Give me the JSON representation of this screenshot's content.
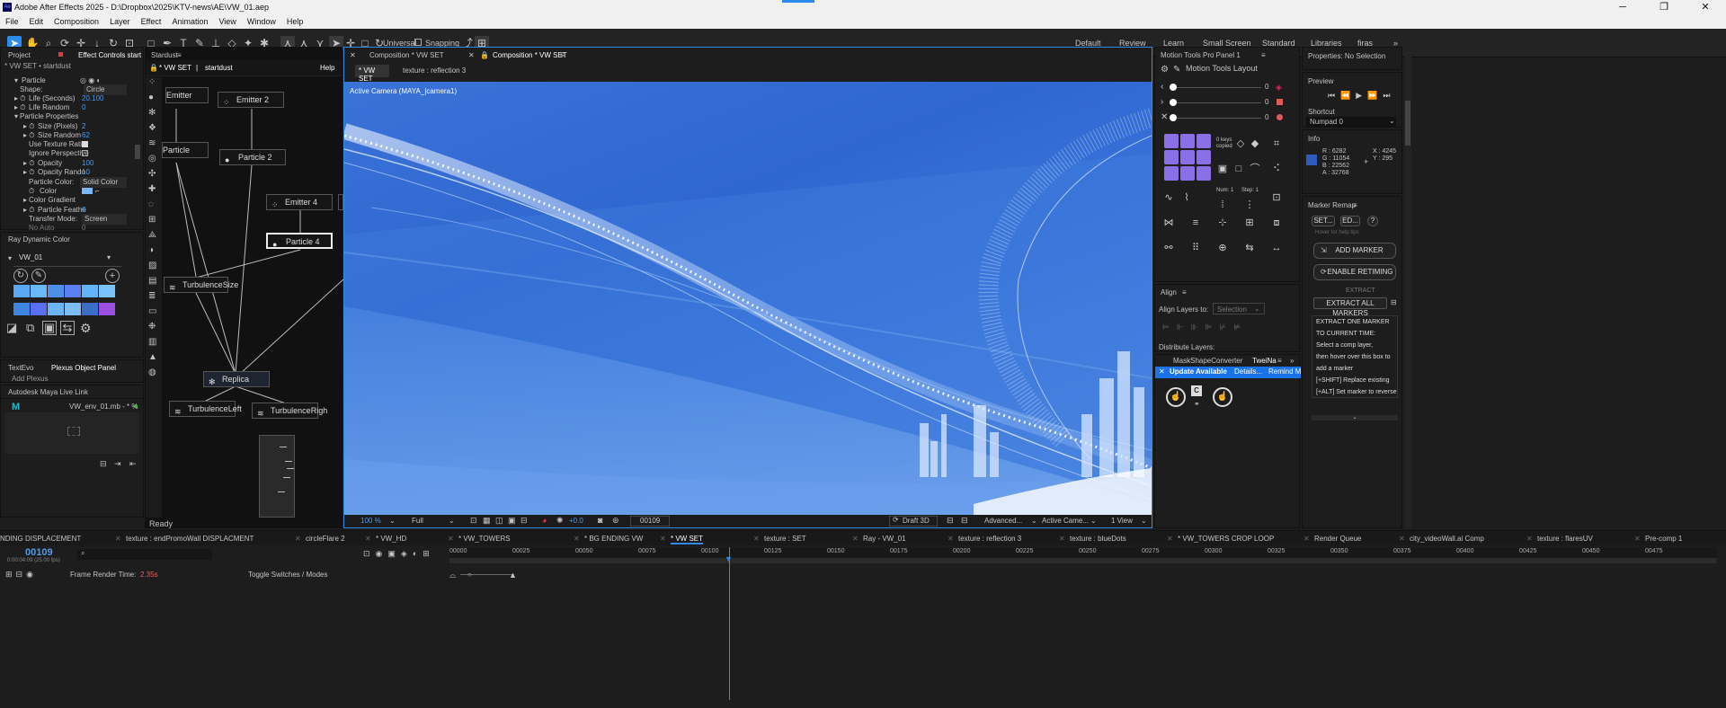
{
  "app": {
    "title": "Adobe After Effects 2025 - D:\\Dropbox\\2025\\KTV-news\\AE\\VW_01.aep",
    "window_buttons": [
      "─",
      "❐",
      "✕"
    ]
  },
  "menu": [
    "File",
    "Edit",
    "Composition",
    "Layer",
    "Effect",
    "Animation",
    "View",
    "Window",
    "Help"
  ],
  "toolbar": {
    "universal_label": "Universal",
    "snapping_label": "Snapping",
    "workspaces": [
      "Default",
      "Review",
      "Learn",
      "Small Screen",
      "Standard",
      "Libraries",
      "firas"
    ]
  },
  "project_panel": {
    "tab_project": "Project",
    "tab_effect_controls": "Effect Controls start",
    "layer_path": "* VW SET • startdust",
    "properties": [
      {
        "label": "Particle",
        "value": ""
      },
      {
        "label": "Shape:",
        "value": "Circle"
      },
      {
        "label": "Life (Seconds)",
        "value": "20.100"
      },
      {
        "label": "Life Random",
        "value": "0"
      },
      {
        "label": "Particle Properties",
        "value": ""
      },
      {
        "label": "Size (Pixels)",
        "value": "2"
      },
      {
        "label": "Size Random",
        "value": "62"
      },
      {
        "label": "Use Texture Ratio",
        "value": ""
      },
      {
        "label": "Ignore Perspective",
        "value": ""
      },
      {
        "label": "Opacity",
        "value": "100"
      },
      {
        "label": "Opacity Rando",
        "value": "10"
      },
      {
        "label": "Particle Color:",
        "value": "Solid Color"
      },
      {
        "label": "Color",
        "value": ""
      },
      {
        "label": "Color Gradient",
        "value": ""
      },
      {
        "label": "Particle Feathe",
        "value": "0"
      },
      {
        "label": "Transfer Mode:",
        "value": "Screen"
      },
      {
        "label": "No Auto",
        "value": "0"
      }
    ]
  },
  "ray_dynamic": {
    "title": "Ray Dynamic Color",
    "palette_name": "VW_01",
    "swatches": [
      "#5aa8f5",
      "#6ab8f7",
      "#4e8fea",
      "#5b7ff0",
      "#63b3f8",
      "#7ac2f9",
      "#3f86e3",
      "#5a6ff0",
      "#6cb5fa",
      "#7bbdfc",
      "#3b6ec8",
      "#9a4fe0"
    ]
  },
  "plexus": {
    "tab_textevo": "TextEvo",
    "tab_plexus": "Plexus Object Panel",
    "add_plexus": "Add Plexus"
  },
  "maya": {
    "title": "Autodesk Maya Live Link",
    "file": "VW_env_01.mb - * %"
  },
  "stardust": {
    "tab": "Stardust",
    "comp_name": "* VW SET",
    "layer": "startdust",
    "help": "Help",
    "status": "Ready",
    "nodes": {
      "emitter1": "Emitter",
      "emitter2": "Emitter 2",
      "particle1": "Particle",
      "particle2": "Particle 2",
      "emitter4": "Emitter 4",
      "particle4": "Particle 4",
      "turbsize": "TurbulenceSize",
      "replica": "Replica",
      "turbleft": "TurbulenceLeft",
      "turbright": "TurbulenceRigh"
    }
  },
  "composition": {
    "tab1": "Composition * VW SET",
    "tab2": "Composition * VW SET",
    "crumb_active": "* VW SET",
    "crumb_2": "texture : reflection 3",
    "camera_label": "Active Camera (MAYA_|camera1)",
    "zoom": "100 %",
    "resolution": "Full",
    "exposure": "+0.0",
    "timecode": "00109",
    "renderer": "Draft 3D",
    "advanced": "Advanced...",
    "camera": "Active Came...",
    "views": "1 View"
  },
  "motion_tools": {
    "title": "Motion Tools Pro Panel 1",
    "layout_label": "Motion Tools Layout",
    "slider_values": [
      "0",
      "0",
      "0"
    ],
    "keys_copied": "0 keys copied",
    "num_label": "Num: 1",
    "step_label": "Step: 1"
  },
  "align": {
    "title": "Align",
    "align_layers_to": "Align Layers to:",
    "selection": "Selection",
    "distribute": "Distribute Layers:"
  },
  "mask_converter": {
    "tab1": "MaskShapeConverter",
    "tab2": "TweiNa",
    "update": "Update Available",
    "details": "Details...",
    "remind": "Remind Me"
  },
  "properties_panel": {
    "title": "Properties: No Selection"
  },
  "preview": {
    "title": "Preview",
    "shortcut_label": "Shortcut",
    "shortcut_value": "Numpad 0"
  },
  "info": {
    "title": "Info",
    "r": "R : 6282",
    "g": "G : 11054",
    "b": "B : 22562",
    "a": "A : 32768",
    "x": "X : 4245",
    "y": "Y : 295",
    "swatch_color": "#2f5bbd"
  },
  "marker_remap": {
    "title": "Marker Remap",
    "set": "SET...",
    "ed": "ED...",
    "hint": "Hover for help tips",
    "add_marker": "ADD MARKER",
    "enable_retiming": "ENABLE RETIMING",
    "extract": "EXTRACT",
    "extract_all": "EXTRACT ALL MARKERS",
    "info_lines": [
      "EXTRACT ONE MARKER",
      "TO CURRENT TIME:",
      "Select a comp layer,",
      "then hover over this box to",
      "add a marker",
      "[+SHIFT] Replace existing",
      "[+ALT] Set marker to reverse"
    ]
  },
  "timeline": {
    "tabs": [
      "NDING DISPLACEMENT",
      "texture : endPromoWall DISPLACMENT",
      "circleFlare 2",
      "* VW_HD",
      "* VW_TOWERS",
      "* BG ENDING VW",
      "* VW SET",
      "texture : SET",
      "Ray - VW_01",
      "texture : reflection 3",
      "texture : blueDots",
      "* VW_TOWERS CROP LOOP",
      "Render Queue",
      "city_videoWall.ai Comp",
      "texture : flaresUV",
      "Pre-comp 1"
    ],
    "active_tab": "* VW SET",
    "current_frame": "00109",
    "sub_time": "0:00:04:09 (25.00 fps)",
    "ruler": [
      "00000",
      "00025",
      "00050",
      "00075",
      "00100",
      "00125",
      "00150",
      "00175",
      "00200",
      "00225",
      "00250",
      "00275",
      "00300",
      "00325",
      "00350",
      "00375",
      "00400",
      "00425",
      "00450",
      "00475"
    ],
    "frame_render_label": "Frame Render Time:",
    "frame_render_value": "2.35s",
    "toggle": "Toggle Switches / Modes"
  },
  "colors": {
    "accent": "#2d8ceb",
    "purple": "#8a6fe6",
    "viewer_bg": "#2f67d0"
  }
}
